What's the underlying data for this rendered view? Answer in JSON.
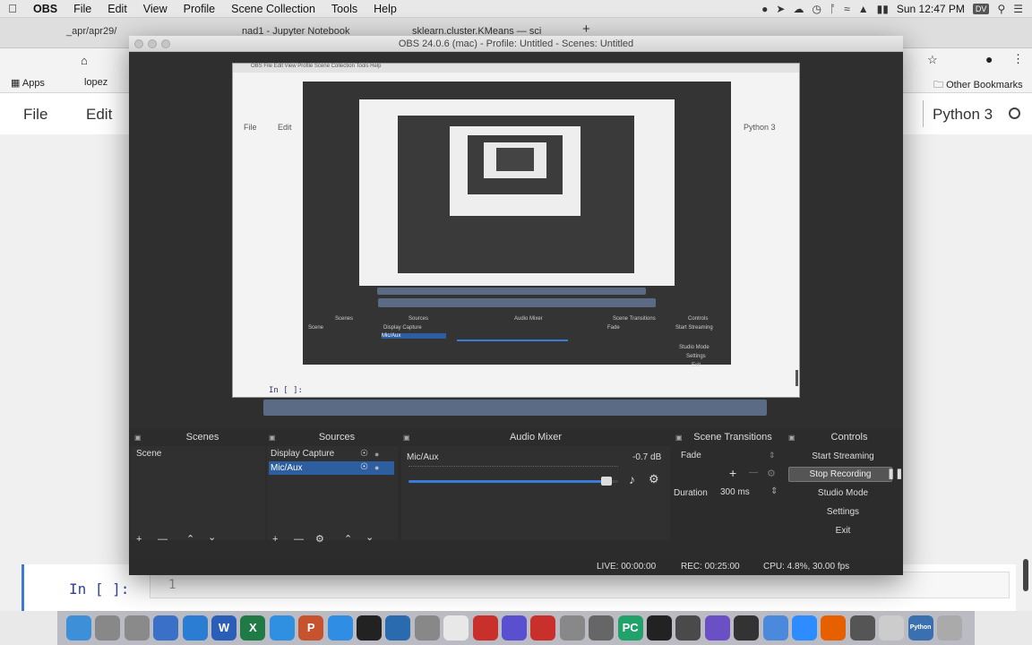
{
  "menubar": {
    "app": "OBS",
    "items": [
      "File",
      "Edit",
      "View",
      "Profile",
      "Scene Collection",
      "Tools",
      "Help"
    ],
    "clock": "Sun 12:47 PM",
    "user": "DV"
  },
  "browser": {
    "tabs": [
      "_apr/apr29/",
      "nad1 - Jupyter Notebook",
      "sklearn.cluster.KMeans — sci"
    ],
    "bookmarks": {
      "apps": "Apps",
      "item": "lopez",
      "other": "Other Bookmarks"
    },
    "notebook_menu": {
      "file": "File",
      "edit": "Edit",
      "kernel": "Python 3"
    },
    "cell": {
      "prompt": "In [ ]:",
      "line": "1"
    }
  },
  "obs": {
    "title": "OBS 24.0.6 (mac) - Profile: Untitled - Scenes: Untitled",
    "scenes": {
      "header": "Scenes",
      "items": [
        "Scene"
      ]
    },
    "sources": {
      "header": "Sources",
      "items": [
        "Display Capture",
        "Mic/Aux"
      ]
    },
    "mixer": {
      "header": "Audio Mixer",
      "channel": "Mic/Aux",
      "level": "-0.7 dB",
      "volume": 0.97
    },
    "transitions": {
      "header": "Scene Transitions",
      "type": "Fade",
      "duration_label": "Duration",
      "duration_value": "300 ms"
    },
    "controls": {
      "header": "Controls",
      "start_streaming": "Start Streaming",
      "stop_recording": "Stop Recording",
      "studio_mode": "Studio Mode",
      "settings": "Settings",
      "exit": "Exit"
    },
    "status": {
      "live": "LIVE: 00:00:00",
      "rec": "REC: 00:25:00",
      "cpu": "CPU: 4.8%, 30.00 fps"
    }
  },
  "preview_text": {
    "title": "OBS 24.0.6 (mac) - Profile: Untitled - Scenes: Untitled",
    "scenes": "Scenes",
    "sources": "Sources",
    "mixer": "Audio Mixer",
    "transitions": "Scene Transitions",
    "controls": "Controls",
    "scene": "Scene",
    "display": "Display Capture",
    "mic": "Mic/Aux",
    "fade": "Fade",
    "start": "Start Streaming",
    "studio": "Studio Mode",
    "settings": "Settings",
    "exit": "Exit",
    "prompt": "In [ ]:",
    "file": "File",
    "edit": "Edit",
    "python": "Python 3"
  },
  "icons": [
    "apple-icon",
    "wifi-icon",
    "volume-icon",
    "battery-icon",
    "search-icon",
    "eye-icon",
    "lock-icon",
    "gear-icon",
    "plus-icon",
    "minus-icon",
    "chevron-up-icon",
    "chevron-down-icon"
  ],
  "dock": [
    "finder",
    "chrome",
    "preview",
    "keynote",
    "outlook",
    "word",
    "excel",
    "safari",
    "powerpoint",
    "appstore",
    "terminal",
    "xcode",
    "system-prefs",
    "slack",
    "creative-cloud",
    "vs",
    "acrobat",
    "script-editor",
    "clock",
    "pycharm",
    "github",
    "help",
    "imovie",
    "iterm",
    "keynote2",
    "zoom",
    "firefox",
    "monitor",
    "files",
    "python",
    "trash"
  ],
  "dock_labels": {
    "word": "W",
    "excel": "X",
    "powerpoint": "P",
    "pycharm": "PC",
    "python": "Python"
  }
}
